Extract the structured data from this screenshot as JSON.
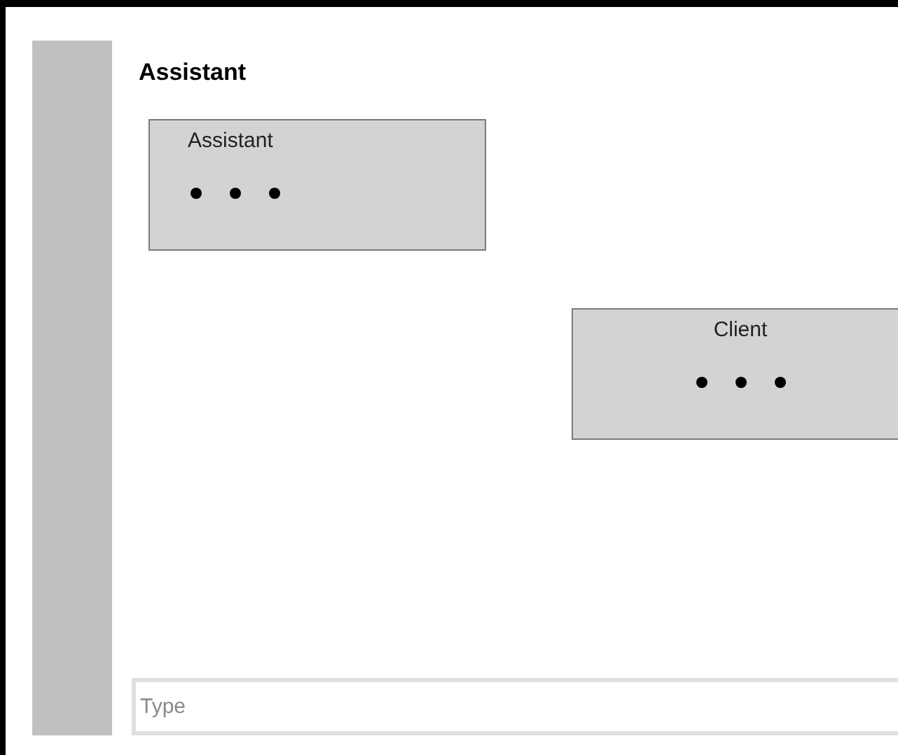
{
  "header": {
    "title": "Assistant"
  },
  "messages": [
    {
      "sender": "Assistant",
      "kind": "received",
      "typing": true
    },
    {
      "sender": "Client",
      "kind": "sent",
      "typing": true
    }
  ],
  "composer": {
    "placeholder": "Type"
  }
}
